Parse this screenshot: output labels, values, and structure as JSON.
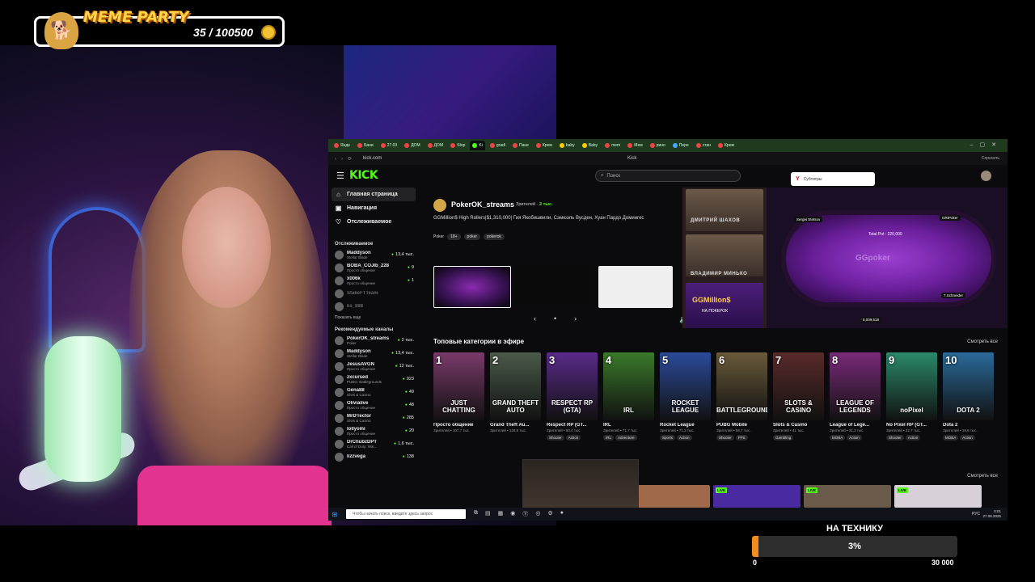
{
  "meme_party": {
    "title": "MEME PARTY",
    "count": "35 / 100500",
    "colors": {
      "title": "#ffd54a",
      "coin": "#f2c230"
    }
  },
  "browser": {
    "tabs": [
      "Янде",
      "Бани",
      "27.03",
      "ДОМ",
      "ДОМ",
      "Stop",
      "Ki",
      "gradi",
      "Пане",
      "Крем",
      "baby",
      "Baby",
      "mem",
      "Мем",
      "рино",
      "Пере",
      "стан",
      "Крем"
    ],
    "url": "kick.com",
    "page_title": "Kick",
    "right_action": "Спросить"
  },
  "kick": {
    "logo": "KICK",
    "search_placeholder": "Поиск",
    "yandex_popup": {
      "letter": "Y",
      "label": "Субтитры"
    },
    "nav": [
      {
        "label": "Главная страница",
        "icon": "⌂"
      },
      {
        "label": "Навигация",
        "icon": "▣"
      },
      {
        "label": "Отслеживаемое",
        "icon": "♡"
      }
    ],
    "followed_title": "Отслеживаемое",
    "followed": [
      {
        "name": "Maddyson",
        "category": "Stellar Blade",
        "viewers": "13,4 тыс."
      },
      {
        "name": "BOBA_COJIb_228",
        "category": "Просто общение",
        "viewers": "9"
      },
      {
        "name": "x006k",
        "category": "Просто общение",
        "viewers": "1"
      },
      {
        "name": "StakeFTTeam",
        "category": "",
        "viewers": ""
      },
      {
        "name": "ks_888",
        "category": "",
        "viewers": ""
      }
    ],
    "show_more": "Показать еще",
    "recommended_title": "Рекомендуемые каналы",
    "recommended": [
      {
        "name": "PokerOK_streams",
        "category": "Poker",
        "viewers": "2 тыс."
      },
      {
        "name": "Maddyson",
        "category": "Stellar Blade",
        "viewers": "13,4 тыс."
      },
      {
        "name": "JesusAVGN",
        "category": "Просто общение",
        "viewers": "12 тыс."
      },
      {
        "name": "zxcursed",
        "category": "PUBG: Battlegrounds",
        "viewers": "923"
      },
      {
        "name": "Gena88",
        "category": "Slots & Casino",
        "viewers": "49"
      },
      {
        "name": "Olivialive",
        "category": "Просто общение",
        "viewers": "48"
      },
      {
        "name": "MrD'rector",
        "category": "Slots & Casino",
        "viewers": "285"
      },
      {
        "name": "lollyomi",
        "category": "Просто общение",
        "viewers": "20"
      },
      {
        "name": "DrChubzDPT",
        "category": "Call of Duty: War...",
        "viewers": "1,6 тыс."
      },
      {
        "name": "lizzvega",
        "category": "",
        "viewers": "138"
      }
    ],
    "featured": {
      "channel": "PokerOK_streams",
      "viewers_label": "Зрителей",
      "viewers": "2 тыс.",
      "title": "GGMillion$ High Rollers|$1,310,000| Гия Якобишвили, Сэмюэль Вусден, Хуан Пардо Домингес",
      "tags": [
        "Poker",
        "18+",
        "poker",
        "pokerok"
      ],
      "player": {
        "cam1": "ДМИТРИЙ ШАХОВ",
        "cam2": "ВЛАДИМИР МИНЬКО",
        "promo": "GGMillion$",
        "promo_sub": "НА ПОКЕРОК",
        "table_logo": "GGpoker",
        "total_pot": "Total Pot : 220,000",
        "seats": [
          "Sergei Stetsov",
          "GRIPoker",
          "7.Schneider",
          "5,009,518"
        ]
      }
    },
    "categories_title": "Топовые категории в эфире",
    "see_all": "Смотреть все",
    "categories": [
      {
        "rank": "1",
        "art": "JUST CHATTING",
        "name": "Просто общение",
        "viewers": "Зрителей • 107,7 тыс.",
        "tags": [],
        "color": "#7a3a6a"
      },
      {
        "rank": "2",
        "art": "GRAND THEFT AUTO",
        "name": "Grand Theft Au...",
        "viewers": "Зрителей • 128,5 тыс.",
        "tags": [],
        "color": "#4a5a4a"
      },
      {
        "rank": "3",
        "art": "RESPECT RP (GTA)",
        "name": "Respect RP (GT...",
        "viewers": "Зрителей • 80,4 тыс.",
        "tags": [
          "Shooter",
          "Action"
        ],
        "color": "#5a2a8a"
      },
      {
        "rank": "4",
        "art": "IRL",
        "name": "IRL",
        "viewers": "Зрителей • 71,7 тыс.",
        "tags": [
          "IRL",
          "Adventure"
        ],
        "color": "#3a7a2a"
      },
      {
        "rank": "5",
        "art": "ROCKET LEAGUE",
        "name": "Rocket League",
        "viewers": "Зрителей • 71,3 тыс.",
        "tags": [
          "Sports",
          "Action"
        ],
        "color": "#2a4a9a"
      },
      {
        "rank": "6",
        "art": "BATTLEGROUNDS",
        "name": "PUBG Mobile",
        "viewers": "Зрителей • 58,7 тыс.",
        "tags": [
          "Shooter",
          "FPS"
        ],
        "color": "#6a5a3a"
      },
      {
        "rank": "7",
        "art": "SLOTS & CASINO",
        "name": "Slots & Casino",
        "viewers": "Зрителей • 41 тыс.",
        "tags": [
          "Gambling"
        ],
        "color": "#5a2a2a"
      },
      {
        "rank": "8",
        "art": "LEAGUE OF LEGENDS",
        "name": "League of Lege...",
        "viewers": "Зрителей • 31,3 тыс.",
        "tags": [
          "MOBA",
          "Action"
        ],
        "color": "#7a2a7a"
      },
      {
        "rank": "9",
        "art": "noPixel",
        "name": "No Pixel RP (GT...",
        "viewers": "Зрителей • 22,7 тыс.",
        "tags": [
          "Shooter",
          "Action"
        ],
        "color": "#2a8a6a"
      },
      {
        "rank": "10",
        "art": "DOTA 2",
        "name": "Dota 2",
        "viewers": "Зрителей • 19,6 тыс.",
        "tags": [
          "MOBA",
          "Action"
        ],
        "color": "#2a6a9a"
      }
    ],
    "live_badge": "LIVE"
  },
  "taskbar": {
    "search_placeholder": "Чтобы начать поиск, введите здесь запрос",
    "lang": "РУС",
    "time": "0:01",
    "date": "27.08.2025"
  },
  "goal": {
    "title": "НА ТЕХНИКУ",
    "percent_label": "3%",
    "percent": 3,
    "min": "0",
    "max": "30 000",
    "fill_color": "#f28c1b"
  }
}
